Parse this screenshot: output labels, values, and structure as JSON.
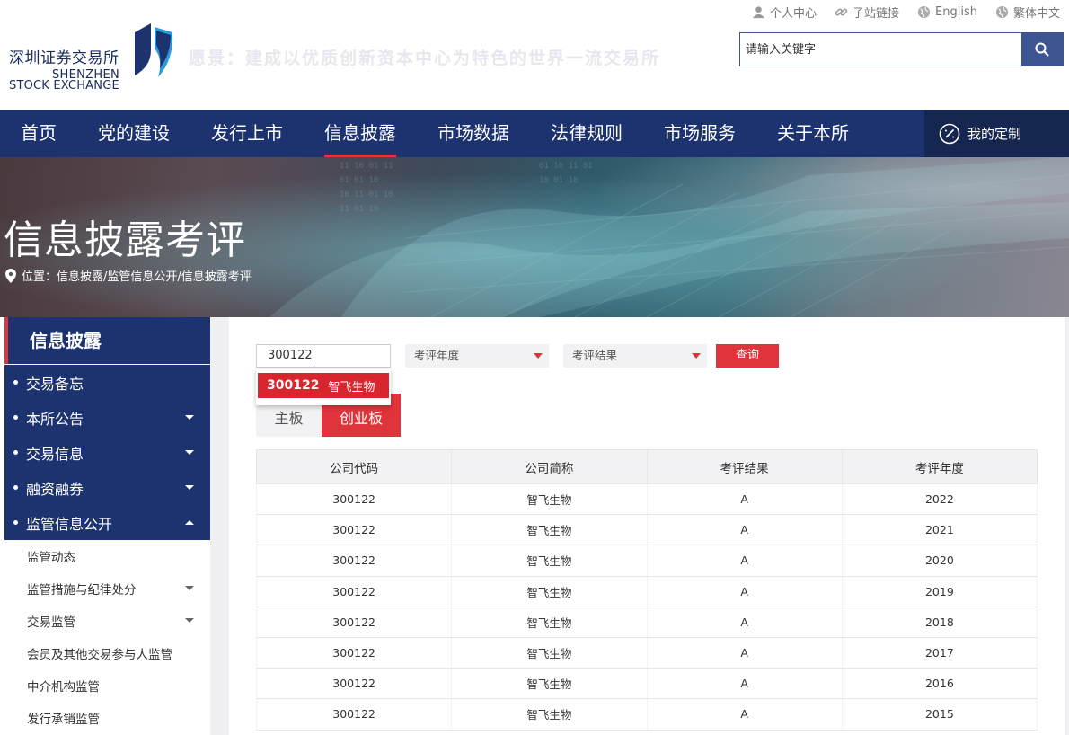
{
  "header": {
    "logo_cn": "深圳证券交易所",
    "logo_en_line1": "SHENZHEN",
    "logo_en_line2": "STOCK EXCHANGE",
    "slogan": "愿景：建成以优质创新资本中心为特色的世界一流交易所",
    "top_links": [
      {
        "label": "个人中心",
        "icon": "user-icon"
      },
      {
        "label": "子站链接",
        "icon": "link-icon"
      },
      {
        "label": "English",
        "icon": "globe-icon"
      },
      {
        "label": "繁体中文",
        "icon": "globe-icon"
      }
    ],
    "search": {
      "placeholder": "请输入关键字",
      "icon": "search-icon"
    }
  },
  "nav": {
    "items": [
      "首页",
      "党的建设",
      "发行上市",
      "信息披露",
      "市场数据",
      "法律规则",
      "市场服务",
      "关于本所"
    ],
    "active": "信息披露",
    "custom_label": "我的定制"
  },
  "banner": {
    "title": "信息披露考评",
    "breadcrumb": "位置：信息披露/监管信息公开/信息披露考评"
  },
  "sidebar": {
    "title": "信息披露",
    "main_items": [
      {
        "label": "交易备忘",
        "caret": "none"
      },
      {
        "label": "本所公告",
        "caret": "down"
      },
      {
        "label": "交易信息",
        "caret": "down"
      },
      {
        "label": "融资融券",
        "caret": "down"
      },
      {
        "label": "监管信息公开",
        "caret": "up"
      }
    ],
    "sub_items": [
      {
        "label": "监管动态",
        "caret": false
      },
      {
        "label": "监管措施与纪律处分",
        "caret": true
      },
      {
        "label": "交易监管",
        "caret": true
      },
      {
        "label": "会员及其他交易参与人监管",
        "caret": false
      },
      {
        "label": "中介机构监管",
        "caret": false
      },
      {
        "label": "发行承销监管",
        "caret": false
      }
    ]
  },
  "filters": {
    "code_value": "300122",
    "year_select": "考评年度",
    "result_select": "考评结果",
    "query_label": "查询"
  },
  "suggestion": {
    "code": "300122",
    "name": "智飞生物"
  },
  "tabs": {
    "items": [
      "主板",
      "创业板"
    ],
    "active": "创业板"
  },
  "table": {
    "columns": [
      "公司代码",
      "公司简称",
      "考评结果",
      "考评年度"
    ],
    "rows": [
      [
        "300122",
        "智飞生物",
        "A",
        "2022"
      ],
      [
        "300122",
        "智飞生物",
        "A",
        "2021"
      ],
      [
        "300122",
        "智飞生物",
        "A",
        "2020"
      ],
      [
        "300122",
        "智飞生物",
        "A",
        "2019"
      ],
      [
        "300122",
        "智飞生物",
        "A",
        "2018"
      ],
      [
        "300122",
        "智飞生物",
        "A",
        "2017"
      ],
      [
        "300122",
        "智飞生物",
        "A",
        "2016"
      ],
      [
        "300122",
        "智飞生物",
        "A",
        "2015"
      ]
    ]
  },
  "colors": {
    "navy": "#1d3370",
    "red": "#e0343c",
    "search_blue": "#3d5592"
  }
}
